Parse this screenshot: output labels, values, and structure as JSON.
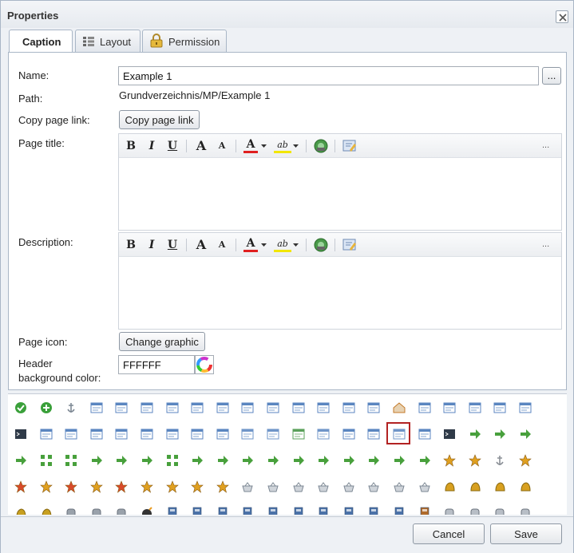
{
  "dialog": {
    "title": "Properties",
    "close_icon": "close-icon"
  },
  "tabs": [
    {
      "label": "Caption",
      "icon": "none",
      "active": true
    },
    {
      "label": "Layout",
      "icon": "layout-icon",
      "active": false
    },
    {
      "label": "Permission",
      "icon": "lock-icon",
      "active": false
    }
  ],
  "form": {
    "name_label": "Name:",
    "name_value": "Example 1",
    "browse_label": "...",
    "path_label": "Path:",
    "path_value": "Grundverzeichnis/MP/Example 1",
    "copy_link_label": "Copy page link:",
    "copy_link_button": "Copy page link",
    "page_title_label": "Page title:",
    "description_label": "Description:",
    "page_icon_label": "Page icon:",
    "change_graphic_button": "Change graphic",
    "header_bg_label_line1": "Header",
    "header_bg_label_line2": "background color:",
    "header_bg_value": "FFFFFF"
  },
  "toolbar": {
    "bold": "B",
    "italic": "I",
    "underline": "U",
    "grow": "A",
    "shrink": "A",
    "font_color": "A",
    "highlight": "ab",
    "more": "...",
    "font_color_hex": "#e02020",
    "highlight_hex": "#f2e600"
  },
  "footer": {
    "cancel_label": "Cancel",
    "save_label": "Save"
  },
  "colors": {
    "border": "#a9b6c6",
    "selected_icon_border": "#b22222",
    "icon_green": "#4caf3a",
    "icon_blue": "#4a78b8",
    "icon_orange": "#e89a20"
  }
}
